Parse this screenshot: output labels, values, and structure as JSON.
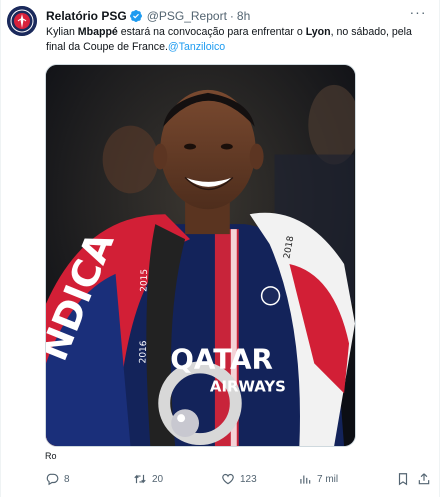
{
  "author": {
    "name": "Relatório PSG",
    "handle": "@PSG_Report",
    "separator": "·",
    "time": "8h",
    "avatar_icon": "psg-crest-icon",
    "verified_icon": "verified-badge-icon"
  },
  "tweet": {
    "part1": "Kylian ",
    "bold1": "Mbappé",
    "part2": " estará na convocação para enfrentar o ",
    "bold2": "Lyon",
    "part3": ", no sábado, pela final da Coupe de France.",
    "mention": "@Tanziloico"
  },
  "media": {
    "caption": "Ro",
    "jersey_sponsor_line1": "QATAR",
    "jersey_sponsor_line2": "AIRWAYS",
    "scarf_text_left": "NDICA",
    "scarf_years_a": "2015",
    "scarf_years_b": "2016",
    "scarf_right_years": "2018"
  },
  "actions": {
    "replies": "8",
    "retweets": "20",
    "likes": "123",
    "views": "7 mil"
  },
  "colors": {
    "accent": "#1d9bf0",
    "muted": "#536471",
    "text": "#0f1419"
  }
}
